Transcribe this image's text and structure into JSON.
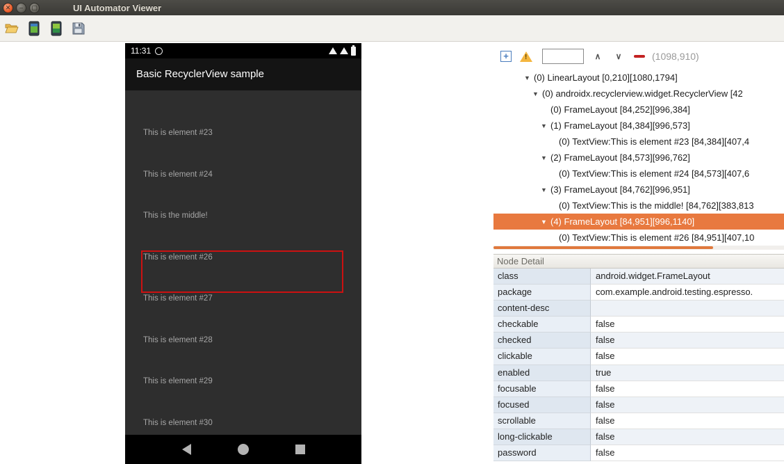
{
  "window": {
    "title": "UI Automator Viewer"
  },
  "colors": {
    "tree_selection": "#e8793f",
    "device_highlight": "#cc1111",
    "scrollbar_thumb": "#e0793d",
    "warning_icon": "#f4b63f"
  },
  "toolbar": {
    "buttons": [
      {
        "name": "open-file",
        "icon": "folder-open-icon"
      },
      {
        "name": "device-screenshot",
        "icon": "device-screenshot-icon"
      },
      {
        "name": "device-screenshot-compressed",
        "icon": "device-screenshot-compressed-icon"
      },
      {
        "name": "save",
        "icon": "save-icon"
      }
    ]
  },
  "device": {
    "status_bar": {
      "time": "11:31",
      "icons": [
        "alarm-icon",
        "wifi-icon",
        "signal-icon",
        "battery-icon"
      ]
    },
    "app_bar": {
      "title": "Basic RecyclerView sample"
    },
    "list_items": [
      "This is element #23",
      "This is element #24",
      "This is the middle!",
      "This is element #26",
      "This is element #27",
      "This is element #28",
      "This is element #29",
      "This is element #30"
    ],
    "highlighted_item": "This is element #26",
    "nav_bar": {
      "icons": [
        "back-icon",
        "home-icon",
        "recents-icon"
      ]
    }
  },
  "inspector": {
    "search_value": "",
    "coordinates": "(1098,910)",
    "tree": [
      {
        "label": "(0) LinearLayout [0,210][1080,1794]",
        "depth": 0,
        "expandable": true,
        "selected": false
      },
      {
        "label": "(0) androidx.recyclerview.widget.RecyclerView [42",
        "depth": 1,
        "expandable": true,
        "selected": false
      },
      {
        "label": "(0) FrameLayout [84,252][996,384]",
        "depth": 2,
        "expandable": false,
        "selected": false
      },
      {
        "label": "(1) FrameLayout [84,384][996,573]",
        "depth": 2,
        "expandable": true,
        "selected": false
      },
      {
        "label": "(0) TextView:This is element #23 [84,384][407,4",
        "depth": 3,
        "expandable": false,
        "selected": false
      },
      {
        "label": "(2) FrameLayout [84,573][996,762]",
        "depth": 2,
        "expandable": true,
        "selected": false
      },
      {
        "label": "(0) TextView:This is element #24 [84,573][407,6",
        "depth": 3,
        "expandable": false,
        "selected": false
      },
      {
        "label": "(3) FrameLayout [84,762][996,951]",
        "depth": 2,
        "expandable": true,
        "selected": false
      },
      {
        "label": "(0) TextView:This is the middle! [84,762][383,813",
        "depth": 3,
        "expandable": false,
        "selected": false
      },
      {
        "label": "(4) FrameLayout [84,951][996,1140]",
        "depth": 2,
        "expandable": true,
        "selected": true
      },
      {
        "label": "(0) TextView:This is element #26 [84,951][407,10",
        "depth": 3,
        "expandable": false,
        "selected": false
      }
    ],
    "node_detail": {
      "title": "Node Detail",
      "rows": [
        {
          "key": "class",
          "value": "android.widget.FrameLayout"
        },
        {
          "key": "package",
          "value": "com.example.android.testing.espresso."
        },
        {
          "key": "content-desc",
          "value": ""
        },
        {
          "key": "checkable",
          "value": "false"
        },
        {
          "key": "checked",
          "value": "false"
        },
        {
          "key": "clickable",
          "value": "false"
        },
        {
          "key": "enabled",
          "value": "true"
        },
        {
          "key": "focusable",
          "value": "false"
        },
        {
          "key": "focused",
          "value": "false"
        },
        {
          "key": "scrollable",
          "value": "false"
        },
        {
          "key": "long-clickable",
          "value": "false"
        },
        {
          "key": "password",
          "value": "false"
        }
      ]
    }
  }
}
